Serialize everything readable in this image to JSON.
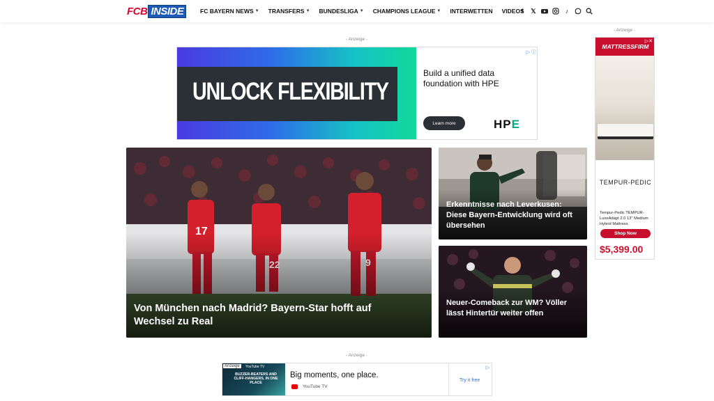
{
  "site": {
    "logo_fcb": "FCB",
    "logo_inside": "INSIDE",
    "nav": [
      {
        "label": "FC Bayern News",
        "dropdown": true
      },
      {
        "label": "Transfers",
        "dropdown": true
      },
      {
        "label": "Bundesliga",
        "dropdown": true
      },
      {
        "label": "Champions League",
        "dropdown": true
      },
      {
        "label": "Interwetten",
        "dropdown": false
      },
      {
        "label": "Videos",
        "dropdown": false
      }
    ],
    "socials": [
      "facebook-icon",
      "x-icon",
      "youtube-icon",
      "instagram-icon",
      "tiktok-icon",
      "whatsapp-icon",
      "search-icon"
    ],
    "colors": {
      "brand_red": "#dc052d",
      "brand_blue": "#1c5bb8"
    }
  },
  "ads": {
    "label": "- Anzeige -",
    "banner": {
      "headline": "UNLOCK FLEXIBILITY",
      "tagline": "Build a unified data foundation with HPE",
      "cta": "Learn more",
      "brand": "HP",
      "brand_e": "E"
    },
    "sidebar": {
      "store": "MATTRESSFIRM",
      "brand": "TEMPUR-PEDIC",
      "description": "Tempur-Pedic TEMPUR-LuxeAdapt 2.0 13\" Medium Hybrid Mattress",
      "price": "$5,399.00",
      "cta": "Shop Now"
    },
    "bottom": {
      "tag": "Anzeige",
      "logo": "YouTube TV",
      "thumb_text": "BUZZER-BEATERS AND CLIFF-HANGERS, IN ONE PLACE",
      "headline": "Big moments, one place.",
      "channel": "YouTube TV",
      "cta": "Try it free"
    }
  },
  "articles": {
    "main": {
      "title": "Von München nach Madrid? Bayern-Star hofft auf Wechsel zu Real"
    },
    "side1": {
      "title": "Erkenntnisse nach Leverkusen: Diese Bayern-Entwicklung wird oft übersehen"
    },
    "side2": {
      "title": "Neuer-Comeback zur WM? Völler lässt Hintertür weiter offen"
    }
  }
}
